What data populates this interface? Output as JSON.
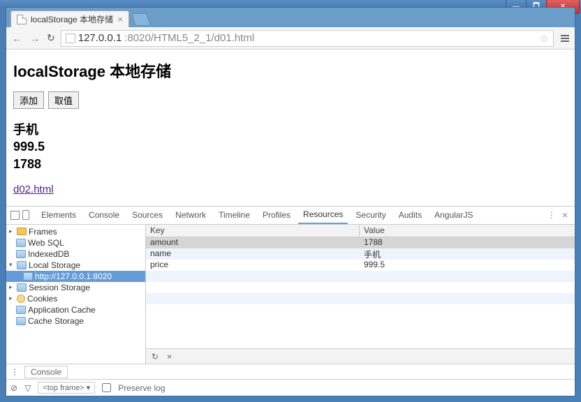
{
  "window": {
    "title_tab": "localStorage 本地存储"
  },
  "addressbar": {
    "url_prefix": "127.0.0.1",
    "url_suffix": ":8020/HTML5_2_1/d01.html"
  },
  "page": {
    "heading": "localStorage 本地存储",
    "btn_add": "添加",
    "btn_get": "取值",
    "output": [
      "手机",
      "999.5",
      "1788"
    ],
    "link": "d02.html"
  },
  "devtools": {
    "tabs": [
      "Elements",
      "Console",
      "Sources",
      "Network",
      "Timeline",
      "Profiles",
      "Resources",
      "Security",
      "Audits",
      "AngularJS"
    ],
    "active_tab": "Resources",
    "sidebar": {
      "frames": "Frames",
      "websql": "Web SQL",
      "indexeddb": "IndexedDB",
      "localstorage": "Local Storage",
      "ls_origin": "http://127.0.0.1:8020",
      "sessionstorage": "Session Storage",
      "cookies": "Cookies",
      "appcache": "Application Cache",
      "cachestorage": "Cache Storage"
    },
    "kv_header": {
      "key": "Key",
      "value": "Value"
    },
    "kv": [
      {
        "k": "amount",
        "v": "1788"
      },
      {
        "k": "name",
        "v": "手机"
      },
      {
        "k": "price",
        "v": "999.5"
      }
    ],
    "consolebar": "Console",
    "bottom": {
      "frame": "<top frame> ▾",
      "preserve": "Preserve log"
    }
  }
}
